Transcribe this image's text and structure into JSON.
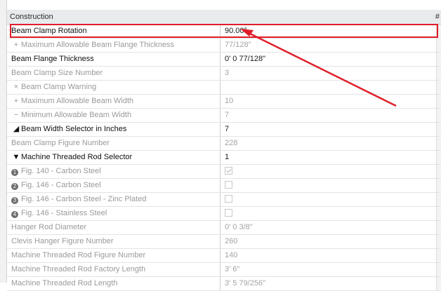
{
  "window": {
    "section_header": "Construction",
    "header_hash": "#"
  },
  "rows": [
    {
      "name": "Beam Clamp Rotation",
      "value": "90.00°",
      "style": "strong",
      "prefix": ""
    },
    {
      "name": "Maximum Allowable Beam Flange Thickness",
      "value": "77/128\"",
      "style": "dim",
      "prefix": "+"
    },
    {
      "name": "Beam Flange Thickness",
      "value": "0'  0 77/128\"",
      "style": "strong",
      "prefix": ""
    },
    {
      "name": "Beam Clamp Size Number",
      "value": "3",
      "style": "dim",
      "prefix": ""
    },
    {
      "name": "Beam Clamp Warning",
      "value": "",
      "style": "dim",
      "prefix": "×"
    },
    {
      "name": "Maximum Allowable Beam Width",
      "value": "10",
      "style": "dim",
      "prefix": "+"
    },
    {
      "name": "Minimum Allowable Beam Width",
      "value": "7",
      "style": "dim",
      "prefix": "−"
    },
    {
      "name": "Beam Width Selector in Inches",
      "value": "7",
      "style": "strong",
      "prefix": "◢"
    },
    {
      "name": "Beam Clamp Figure Number",
      "value": "228",
      "style": "dim",
      "prefix": ""
    },
    {
      "name": "Machine Threaded Rod Selector",
      "value": "1",
      "style": "strong",
      "prefix": "▼"
    },
    {
      "name": "Fig. 140 - Carbon Steel",
      "value": "",
      "style": "dim",
      "prefix": "circle",
      "circle": "1",
      "check": "checked"
    },
    {
      "name": "Fig. 146 - Carbon Steel",
      "value": "",
      "style": "dim",
      "prefix": "circle",
      "circle": "2",
      "check": "empty"
    },
    {
      "name": "Fig. 146 - Carbon Steel - Zinc Plated",
      "value": "",
      "style": "dim",
      "prefix": "circle",
      "circle": "3",
      "check": "empty"
    },
    {
      "name": "Fig. 146 - Stainless Steel",
      "value": "",
      "style": "dim",
      "prefix": "circle",
      "circle": "4",
      "check": "empty"
    },
    {
      "name": "Hanger Rod Diameter",
      "value": "0'  0 3/8\"",
      "style": "dim",
      "prefix": ""
    },
    {
      "name": "Clevis Hanger Figure Number",
      "value": "260",
      "style": "dim",
      "prefix": ""
    },
    {
      "name": "Machine Threaded Rod Figure Number",
      "value": "140",
      "style": "dim",
      "prefix": ""
    },
    {
      "name": "Machine Threaded Rod Factory Length",
      "value": "3'  6\"",
      "style": "dim",
      "prefix": ""
    },
    {
      "name": "Machine Threaded Rod Length",
      "value": "3'  5 79/256\"",
      "style": "dim",
      "prefix": ""
    }
  ],
  "annotations": {
    "highlight_color": "#e01e2a"
  }
}
